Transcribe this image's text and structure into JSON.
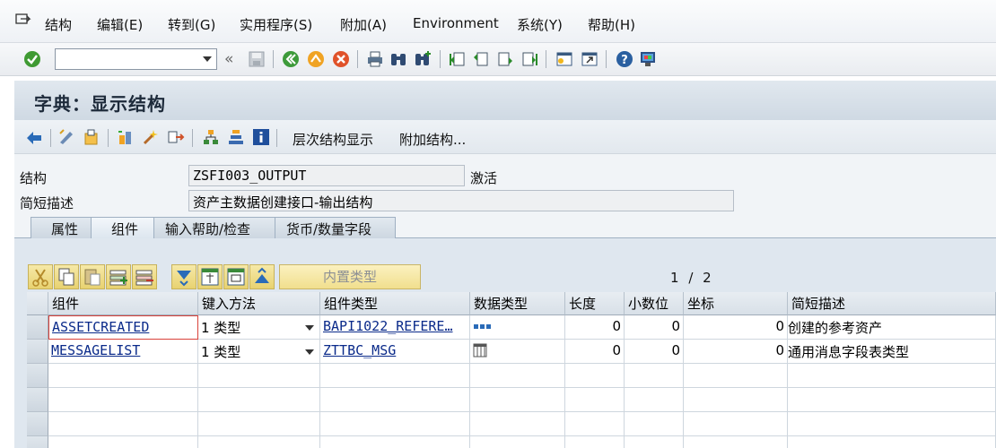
{
  "menu": {
    "items": [
      "结构",
      "编辑(E)",
      "转到(G)",
      "实用程序(S)",
      "附加(A)",
      "Environment",
      "系统(Y)",
      "帮助(H)"
    ]
  },
  "toolbar": {
    "command_field_value": "",
    "collapse_glyph": "«",
    "icons": [
      "enter-check-icon",
      "save-icon",
      "back-icon",
      "exit-icon",
      "cancel-icon",
      "print-icon",
      "find-icon",
      "find-next-icon",
      "first-page-icon",
      "prev-page-icon",
      "next-page-icon",
      "last-page-icon",
      "create-session-icon",
      "shortcut-icon",
      "help-icon",
      "layout-icon"
    ]
  },
  "title": "字典：显示结构",
  "app_toolbar": {
    "hierarchy_label": "层次结构显示",
    "append_label": "附加结构..."
  },
  "form": {
    "structure_label": "结构",
    "structure_value": "ZSFI003_OUTPUT",
    "status": "激活",
    "short_desc_label": "简短描述",
    "short_desc_value": "资产主数据创建接口-输出结构"
  },
  "tabs": [
    {
      "label": "属性",
      "active": false
    },
    {
      "label": "组件",
      "active": true
    },
    {
      "label": "输入帮助/检查",
      "active": false
    },
    {
      "label": "货币/数量字段",
      "active": false
    }
  ],
  "grid_toolbar": {
    "builtin_type_label": "内置类型",
    "page_current": "1",
    "page_separator": "/",
    "page_total": "2"
  },
  "table": {
    "columns": [
      "组件",
      "键入方法",
      "组件类型",
      "数据类型",
      "长度",
      "小数位",
      "坐标",
      "简短描述"
    ],
    "rows": [
      {
        "component": "ASSETCREATED",
        "typing": "1 类型",
        "comp_type": "BAPI1022_REFERE…",
        "data_type_icon": "structure-icon",
        "length": "0",
        "decimals": "0",
        "coord": "0",
        "desc": "创建的参考资产"
      },
      {
        "component": "MESSAGELIST",
        "typing": "1 类型",
        "comp_type": "ZTTBC_MSG",
        "data_type_icon": "table-type-icon",
        "length": "0",
        "decimals": "0",
        "coord": "0",
        "desc": "通用消息字段表类型"
      }
    ]
  },
  "colors": {
    "title_bg": "#d5dee8",
    "tab_panel_bg": "#dfe7ef",
    "grid_button_yellow": "#f1df8d",
    "link_blue": "#0a2a8a"
  }
}
